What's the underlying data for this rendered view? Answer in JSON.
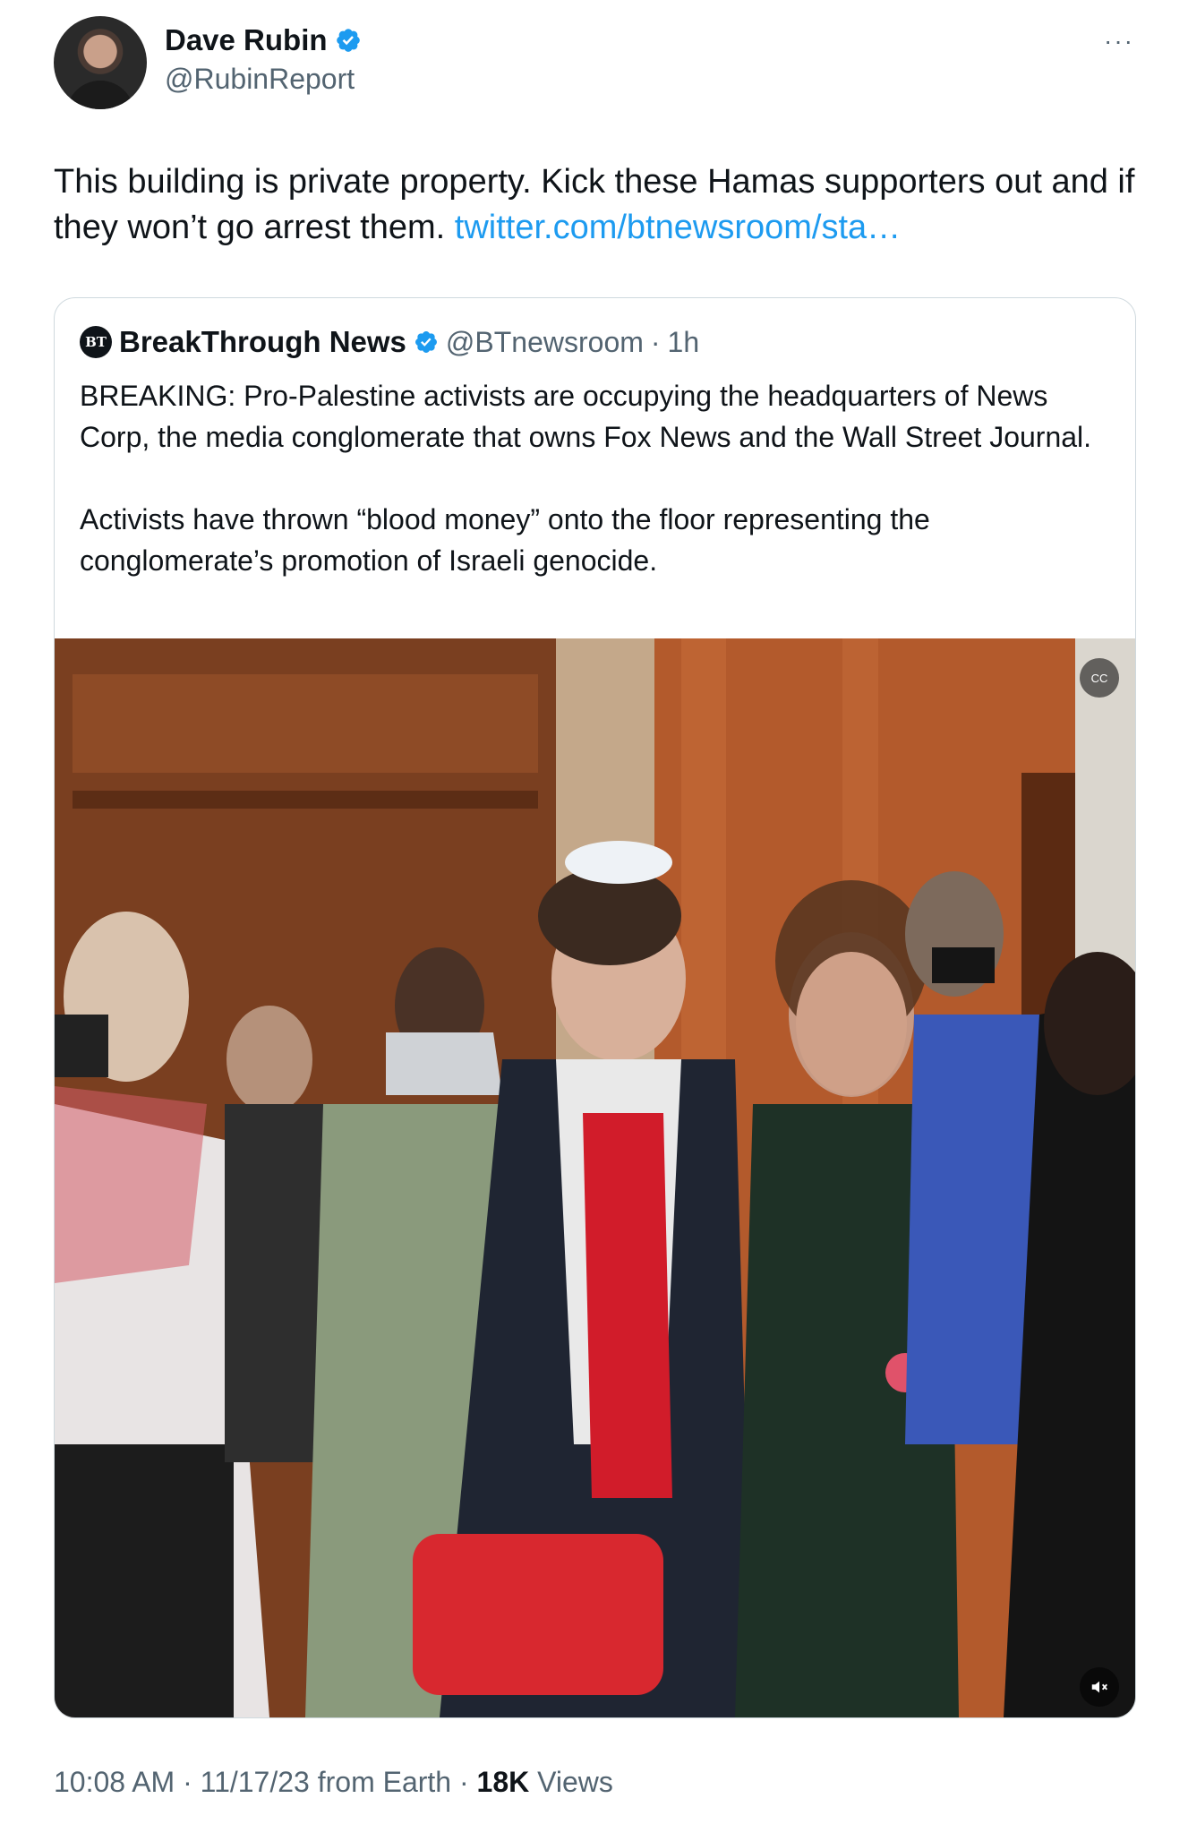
{
  "author": {
    "display_name": "Dave Rubin",
    "handle": "@RubinReport",
    "verified_icon": "verified-badge-icon"
  },
  "more_label": "···",
  "tweet": {
    "text": "This building is private property. Kick these Hamas supporters out and if they won’t go arrest them. ",
    "link": "twitter.com/btnewsroom/sta…"
  },
  "quote": {
    "logo_text": "BT",
    "display_name": "BreakThrough News",
    "handle": "@BTnewsroom",
    "separator": "·",
    "time": "1h",
    "paragraphs": [
      "BREAKING: Pro-Palestine activists are occupying the headquarters of News Corp, the media conglomerate that owns Fox News and the Wall Street Journal.",
      "Activists have thrown “blood money” onto the floor representing the conglomerate’s promotion of Israeli genocide."
    ],
    "media": {
      "type": "video",
      "caption_button_icon": "closed-captions-icon",
      "mute_button_icon": "muted-speaker-icon",
      "caption_label": "CC"
    }
  },
  "meta": {
    "time": "10:08 AM",
    "sep1": " · ",
    "date": "11/17/23",
    "source": " from Earth",
    "sep2": " · ",
    "views_count": "18K",
    "views_label": " Views"
  },
  "colors": {
    "link": "#1d9bf0",
    "secondary_text": "#536471",
    "primary_text": "#0f1419",
    "verified": "#1d9bf0"
  }
}
